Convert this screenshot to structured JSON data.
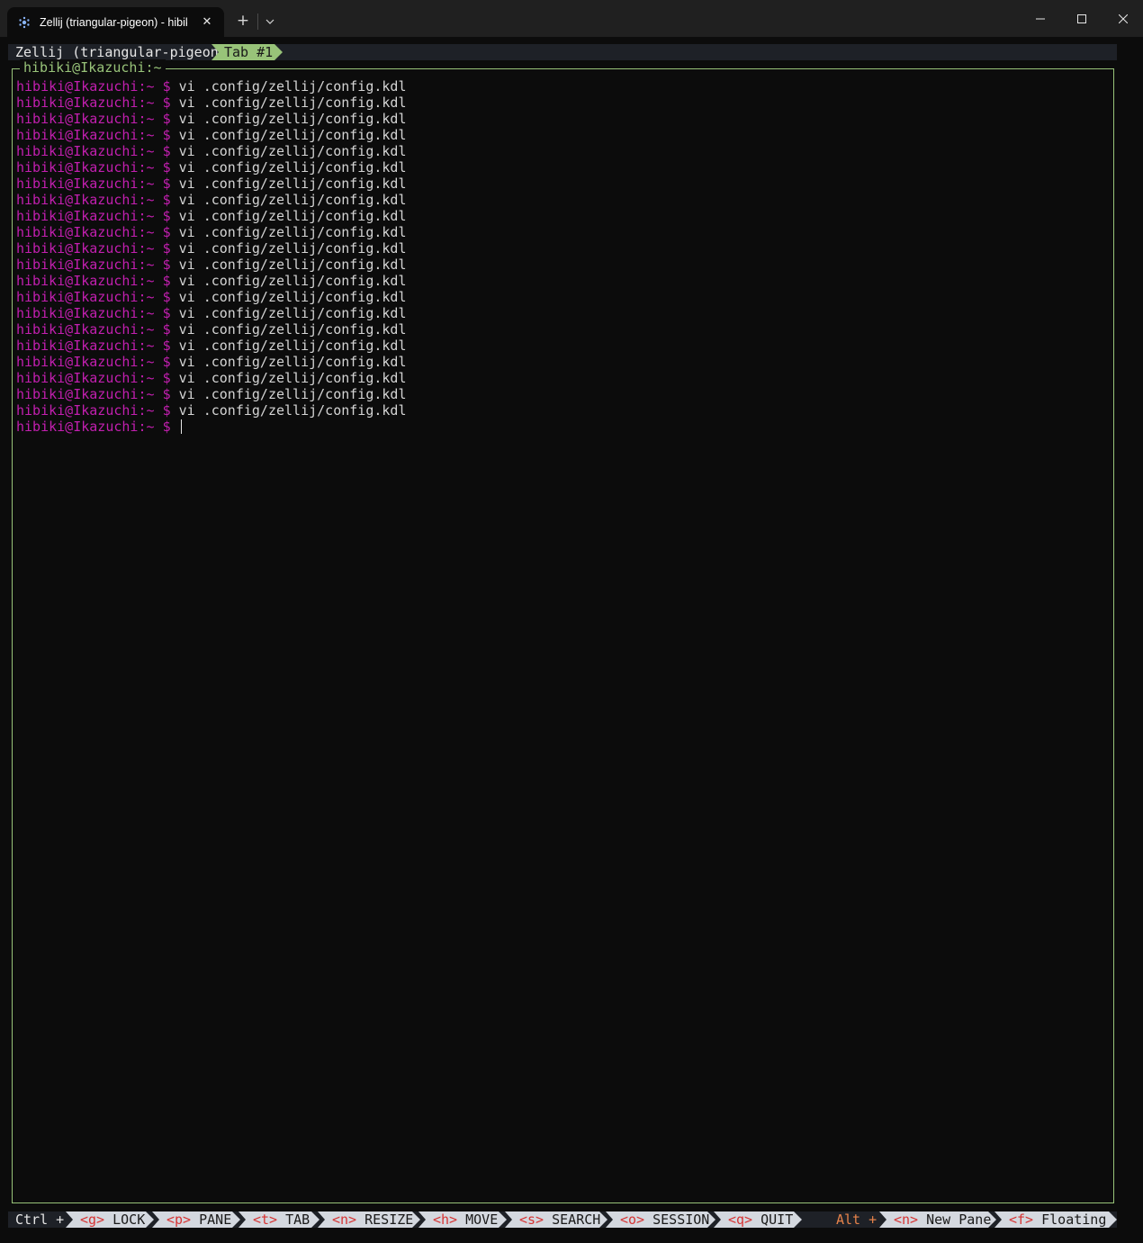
{
  "window": {
    "tab_title": "Zellij (triangular-pigeon) - hibiki@Ikazuchi:~",
    "icons": {
      "tab": "terminal-app-icon",
      "close_tab": "close-icon",
      "new_tab": "plus-icon",
      "dropdown": "chevron-down-icon",
      "minimize": "minimize-icon",
      "maximize": "maximize-icon",
      "close_window": "close-icon"
    },
    "new_tab_glyph": "+",
    "close_glyph": "✕"
  },
  "zellij": {
    "session_label": "Zellij (triangular-pigeon)",
    "active_tab": "Tab #1",
    "pane_title": "hibiki@Ikazuchi:~",
    "accent_color": "#98c379",
    "prompt_color": "#c21faf",
    "key_color": "#d63333",
    "alt_color": "#e5824a"
  },
  "terminal": {
    "prompt_user": "hibiki@Ikazuchi:~",
    "prompt_symbol": "$",
    "lines": [
      "vi .config/zellij/config.kdl",
      "vi .config/zellij/config.kdl",
      "vi .config/zellij/config.kdl",
      "vi .config/zellij/config.kdl",
      "vi .config/zellij/config.kdl",
      "vi .config/zellij/config.kdl",
      "vi .config/zellij/config.kdl",
      "vi .config/zellij/config.kdl",
      "vi .config/zellij/config.kdl",
      "vi .config/zellij/config.kdl",
      "vi .config/zellij/config.kdl",
      "vi .config/zellij/config.kdl",
      "vi .config/zellij/config.kdl",
      "vi .config/zellij/config.kdl",
      "vi .config/zellij/config.kdl",
      "vi .config/zellij/config.kdl",
      "vi .config/zellij/config.kdl",
      "vi .config/zellij/config.kdl",
      "vi .config/zellij/config.kdl",
      "vi .config/zellij/config.kdl",
      "vi .config/zellij/config.kdl",
      ""
    ]
  },
  "status_bar": {
    "ctrl_label": "Ctrl +",
    "alt_label": "Alt +",
    "ctrl_keys": [
      {
        "key": "<g>",
        "label": "LOCK"
      },
      {
        "key": "<p>",
        "label": "PANE"
      },
      {
        "key": "<t>",
        "label": "TAB"
      },
      {
        "key": "<n>",
        "label": "RESIZE"
      },
      {
        "key": "<h>",
        "label": "MOVE"
      },
      {
        "key": "<s>",
        "label": "SEARCH"
      },
      {
        "key": "<o>",
        "label": "SESSION"
      },
      {
        "key": "<q>",
        "label": "QUIT"
      }
    ],
    "alt_keys": [
      {
        "key": "<n>",
        "label": "New Pane"
      },
      {
        "key": "<f>",
        "label": "Floating"
      }
    ]
  }
}
